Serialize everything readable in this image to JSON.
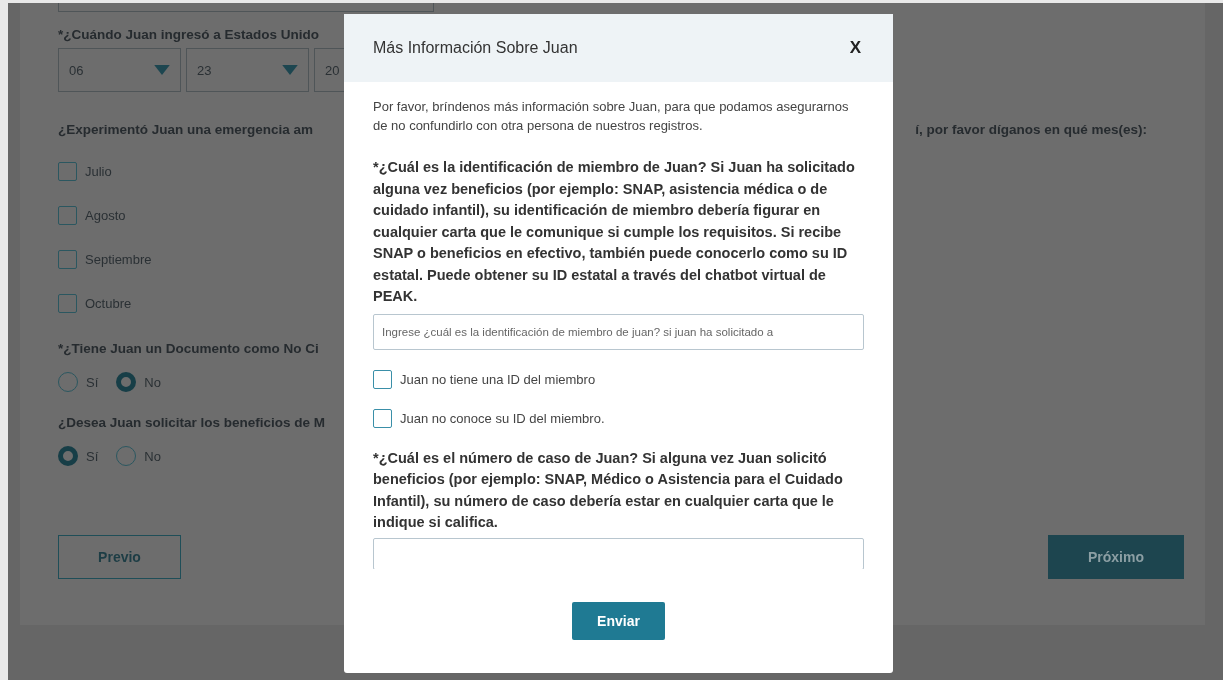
{
  "form": {
    "entry_date": {
      "label": "*¿Cuándo Juan ingresó a Estados Unido",
      "selects": [
        "06",
        "23",
        "20"
      ]
    },
    "emergency": {
      "label_left": "¿Experimentó Juan una emergencia am",
      "label_right": "í, por favor díganos en qué mes(es):",
      "months": [
        {
          "label": "Julio",
          "checked": false
        },
        {
          "label": "Agosto",
          "checked": false
        },
        {
          "label": "Septiembre",
          "checked": false
        },
        {
          "label": "Octubre",
          "checked": false
        }
      ]
    },
    "document": {
      "label": "*¿Tiene Juan un Documento como No Ci",
      "options": [
        {
          "label": "Sí",
          "selected": false
        },
        {
          "label": "No",
          "selected": true
        }
      ]
    },
    "benefits": {
      "label": "¿Desea Juan solicitar los beneficios de M",
      "options": [
        {
          "label": "Sí",
          "selected": true
        },
        {
          "label": "No",
          "selected": false
        }
      ]
    },
    "previous_button": "Previo",
    "next_button": "Próximo"
  },
  "modal": {
    "title": "Más Información Sobre Juan",
    "close": "X",
    "intro": "Por favor, bríndenos más información sobre Juan, para que podamos asegurarnos de no confundirlo con otra persona de nuestros registros.",
    "member_id": {
      "question": "*¿Cuál es la identificación de miembro de Juan? Si Juan ha solicitado alguna vez beneficios (por ejemplo: SNAP, asistencia médica o de cuidado infantil), su identificación de miembro debería figurar en cualquier carta que le comunique si cumple los requisitos. Si recibe SNAP o beneficios en efectivo, también puede conocerlo como su ID estatal. Puede obtener su ID estatal a través del chatbot virtual de PEAK.",
      "placeholder": "Ingrese ¿cuál es la identificación de miembro de juan? si juan ha solicitado a",
      "options": [
        {
          "label": "Juan no tiene una ID del miembro",
          "checked": false
        },
        {
          "label": "Juan no conoce su ID del miembro.",
          "checked": false
        }
      ]
    },
    "case_number": {
      "question": "*¿Cuál es el número de caso de Juan? Si alguna vez Juan solicitó beneficios (por ejemplo: SNAP, Médico o Asistencia para el Cuidado Infantil), su número de caso debería estar en cualquier carta que le indique si califica."
    },
    "submit": "Enviar"
  }
}
